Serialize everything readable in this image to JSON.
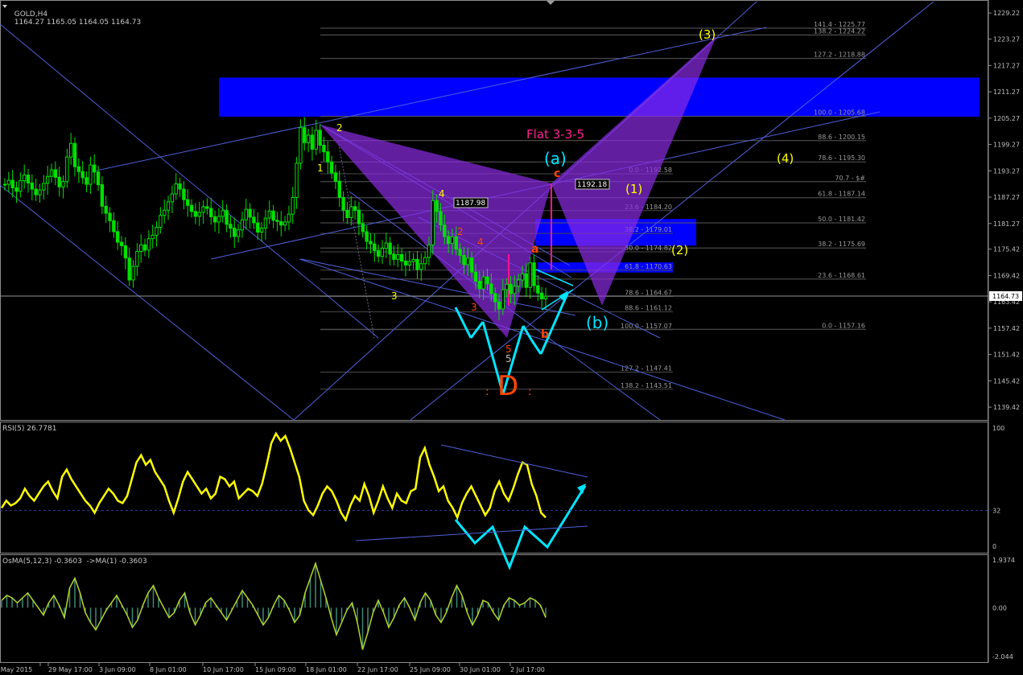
{
  "header": {
    "symbol": "GOLD,H4",
    "ohlc": "1164.27 1165.05 1164.05 1164.73",
    "rsi_label": "RSI(5) 26.7781",
    "osma_label": "OsMA(5,12,3) -0.3603  ->MA(1) -0.3603"
  },
  "chart_data": [
    {
      "type": "line",
      "panel": "price",
      "title": "GOLD,H4",
      "ylim": [
        1136.5,
        1232.0
      ],
      "price_axis_ticks": [
        "1229.22",
        "1223.27",
        "1217.27",
        "1211.27",
        "1205.27",
        "1199.27",
        "1193.27",
        "1187.27",
        "1181.27",
        "1175.42",
        "1169.42",
        "1163.42",
        "1157.42",
        "1151.42",
        "1145.42",
        "1139.42"
      ],
      "current_price": "1164.73",
      "x_labels": [
        "27 May 2015",
        "29 May 17:00",
        "3 Jun 09:00",
        "8 Jun 01:00",
        "10 Jun 17:00",
        "15 Jun 09:00",
        "18 Jun 01:00",
        "22 Jun 17:00",
        "25 Jun 09:00",
        "30 Jun 01:00",
        "2 Jul 17:00"
      ],
      "series": [
        {
          "values": [
            1190.2,
            1191.1,
            1189.4,
            1188.6,
            1191.0,
            1192.3,
            1190.5,
            1189.1,
            1187.8,
            1188.9,
            1190.4,
            1192.0,
            1193.5,
            1191.8,
            1189.6,
            1190.8,
            1196.4,
            1199.5,
            1194.2,
            1193.1,
            1191.7,
            1190.2,
            1194.6,
            1193.0,
            1190.1,
            1185.2,
            1183.6,
            1181.9,
            1179.4,
            1177.0,
            1176.2,
            1173.4,
            1168.4,
            1171.5,
            1174.9,
            1176.4,
            1175.2,
            1177.8,
            1178.6,
            1180.4,
            1183.1,
            1184.3,
            1186.2,
            1188.0,
            1190.3,
            1189.1,
            1186.7,
            1185.4,
            1184.0,
            1182.9,
            1183.8,
            1185.1,
            1184.7,
            1182.8,
            1181.6,
            1182.9,
            1184.2,
            1181.1,
            1180.2,
            1178.3,
            1179.8,
            1182.1,
            1184.5,
            1182.7,
            1181.4,
            1179.3,
            1180.2,
            1182.5,
            1184.1,
            1182.0,
            1181.7,
            1180.9,
            1181.6,
            1183.4,
            1187.2,
            1195.0,
            1203.1,
            1199.7,
            1201.4,
            1198.2,
            1202.5,
            1199.1,
            1197.6,
            1195.3,
            1192.8,
            1190.9,
            1187.2,
            1184.3,
            1182.6,
            1185.1,
            1184.3,
            1181.2,
            1179.4,
            1177.2,
            1176.6,
            1175.1,
            1173.8,
            1175.6,
            1176.8,
            1174.3,
            1173.1,
            1174.2,
            1172.7,
            1171.8,
            1172.6,
            1173.1,
            1170.8,
            1172.1,
            1173.5,
            1176.4,
            1186.5,
            1184.0,
            1180.9,
            1178.3,
            1176.7,
            1178.2,
            1175.4,
            1174.0,
            1171.9,
            1173.4,
            1170.2,
            1168.1,
            1166.4,
            1169.1,
            1167.5,
            1165.3,
            1163.4,
            1161.8,
            1166.2,
            1167.4,
            1165.3,
            1167.0,
            1168.4,
            1169.8,
            1166.7,
            1172.3,
            1167.1,
            1165.4,
            1164.1,
            1164.7
          ]
        }
      ],
      "annotations": {
        "title_text": "Flat 3-3-5",
        "wave_labels_yellow": [
          "(1)",
          "(2)",
          "(3)",
          "(4)"
        ],
        "wave_labels_cyan": [
          "(a)",
          "(b)"
        ],
        "minor_labels": [
          "1",
          "2",
          "3",
          "4",
          "3",
          "4",
          "2",
          "5",
          "5"
        ],
        "pattern_letters": [
          "a",
          "b",
          "c"
        ],
        "point_d": "D",
        "price_marks": [
          "1187.98",
          "1192.18"
        ],
        "fib_right": [
          "141.4 - 1225.77",
          "138.2 - 1224.22",
          "127.2 - 1218.88",
          "100.0 - 1205.68",
          "88.6 - 1200.15",
          "78.6 - 1195.30",
          "70.7 - $#",
          "61.8 - 1187.14",
          "50.0 - 1181.42",
          "38.2 - 1175.69",
          "23.6 - 1168.61",
          "0.0 - 1157.16"
        ],
        "fib_mid": [
          "0.0 - 1192.58",
          "23.6 - 1184.20",
          "38.2 - 1179.01",
          "50.0 - 1174.82",
          "61.8 - 1170.63",
          "78.6 - 1164.67",
          "88.6 - 1161.12",
          "100.0 - 1157.07",
          "127.2 - 1147.41",
          "138.2 - 1143.51"
        ]
      },
      "colors": {
        "candles": "#00e000",
        "zone": "#0000ff",
        "pattern": "#8a2be2",
        "trendlines": "#4f5fd8",
        "cyan": "#00e5ff",
        "yellow": "#ffff00",
        "orange": "#ff4500",
        "magenta": "#ff1493"
      }
    },
    {
      "type": "line",
      "panel": "rsi",
      "title": "RSI(5) 26.7781",
      "ylim": [
        0,
        100
      ],
      "levels": [
        32
      ],
      "axis_ticks": [
        "100",
        "32",
        "0"
      ],
      "series": [
        {
          "name": "RSI(5)",
          "values": [
            34,
            40,
            36,
            38,
            42,
            50,
            44,
            40,
            46,
            52,
            56,
            48,
            42,
            60,
            66,
            58,
            52,
            46,
            40,
            36,
            30,
            38,
            44,
            50,
            46,
            40,
            38,
            44,
            58,
            72,
            78,
            70,
            74,
            64,
            58,
            52,
            40,
            30,
            42,
            56,
            64,
            58,
            52,
            46,
            50,
            42,
            46,
            60,
            58,
            52,
            56,
            42,
            46,
            50,
            48,
            44,
            54,
            70,
            88,
            96,
            90,
            94,
            84,
            72,
            60,
            40,
            32,
            28,
            36,
            46,
            52,
            48,
            40,
            30,
            24,
            36,
            44,
            40,
            54,
            44,
            30,
            40,
            52,
            42,
            34,
            46,
            40,
            38,
            48,
            50,
            76,
            84,
            70,
            60,
            48,
            52,
            40,
            34,
            26,
            38,
            46,
            52,
            44,
            36,
            28,
            34,
            48,
            56,
            46,
            40,
            50,
            62,
            72,
            70,
            54,
            44,
            30,
            26
          ]
        }
      ]
    },
    {
      "type": "bar",
      "panel": "osma",
      "title": "OsMA(5,12,3) -0.3603  ->MA(1) -0.3603",
      "ylim": [
        -2.044,
        1.9374
      ],
      "axis_ticks": [
        "1.9374",
        "0.00",
        "-2.044"
      ],
      "series": [
        {
          "name": "OsMA(5,12,3)",
          "values": [
            0.3,
            0.5,
            0.4,
            0.2,
            0.4,
            0.6,
            0.3,
            0.0,
            -0.3,
            0.2,
            0.5,
            0.1,
            -0.4,
            0.8,
            1.2,
            0.6,
            -0.2,
            -0.6,
            -0.9,
            -0.5,
            -0.1,
            0.2,
            0.5,
            0.1,
            -0.3,
            -0.8,
            -0.5,
            0.1,
            0.6,
            0.9,
            0.4,
            0.0,
            -0.4,
            -0.2,
            0.3,
            0.6,
            -0.2,
            -0.7,
            -0.3,
            0.2,
            0.4,
            0.1,
            -0.2,
            -0.5,
            -0.1,
            0.3,
            0.7,
            0.4,
            0.1,
            -0.3,
            -0.7,
            -0.4,
            0.1,
            0.5,
            0.3,
            -0.1,
            -0.6,
            -0.3,
            0.6,
            1.2,
            1.8,
            1.1,
            0.4,
            -0.4,
            -1.1,
            -0.6,
            -0.1,
            0.2,
            -0.6,
            -1.7,
            -1.0,
            -0.2,
            0.3,
            -0.2,
            -0.8,
            -0.4,
            0.1,
            0.4,
            0.0,
            -0.5,
            0.2,
            0.6,
            0.3,
            -0.3,
            -0.6,
            -0.2,
            0.4,
            0.9,
            0.5,
            -0.2,
            -0.7,
            -0.3,
            0.3,
            0.2,
            -0.2,
            -0.5,
            0.1,
            0.4,
            0.3,
            0.1,
            0.2,
            0.4,
            0.3,
            0.1,
            -0.4
          ]
        }
      ]
    }
  ]
}
